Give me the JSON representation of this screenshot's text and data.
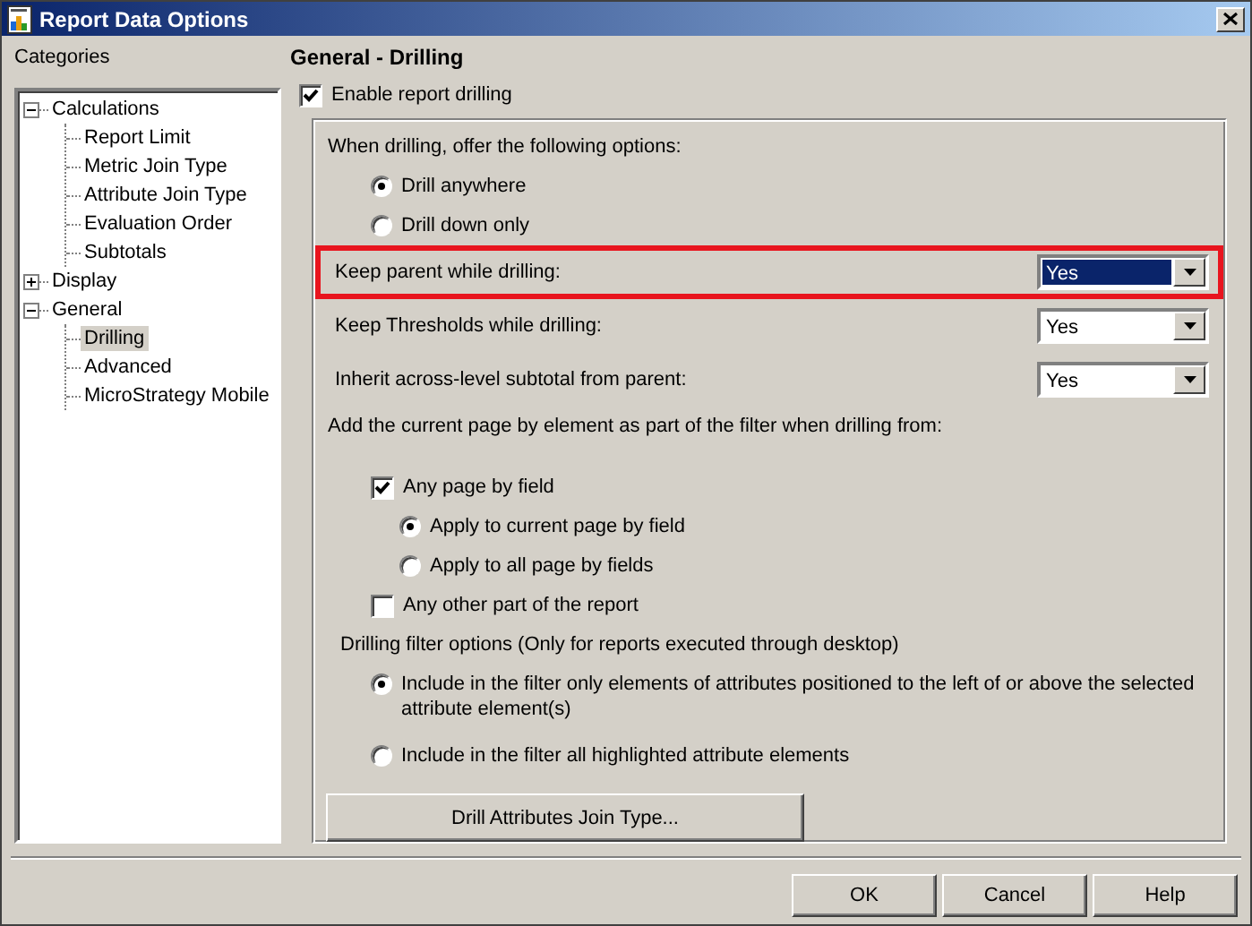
{
  "window": {
    "title": "Report Data Options"
  },
  "categories": {
    "label": "Categories",
    "tree": [
      {
        "label": "Calculations",
        "expanded": true,
        "selected": false,
        "children": [
          {
            "label": "Report Limit",
            "selected": false
          },
          {
            "label": "Metric Join Type",
            "selected": false
          },
          {
            "label": "Attribute Join Type",
            "selected": false
          },
          {
            "label": "Evaluation Order",
            "selected": false
          },
          {
            "label": "Subtotals",
            "selected": false
          }
        ]
      },
      {
        "label": "Display",
        "expanded": false,
        "selected": false
      },
      {
        "label": "General",
        "expanded": true,
        "selected": false,
        "children": [
          {
            "label": "Drilling",
            "selected": true
          },
          {
            "label": "Advanced",
            "selected": false
          },
          {
            "label": "MicroStrategy Mobile",
            "selected": false
          }
        ]
      }
    ]
  },
  "panel": {
    "heading": "General - Drilling",
    "enable": {
      "label": "Enable report drilling",
      "checked": true
    },
    "drill_options": {
      "label": "When drilling, offer the following options:",
      "choices": [
        {
          "label": "Drill anywhere",
          "selected": true
        },
        {
          "label": "Drill down only",
          "selected": false
        }
      ]
    },
    "settings": [
      {
        "label": "Keep parent while drilling:",
        "value": "Yes",
        "highlighted": true
      },
      {
        "label": "Keep Thresholds while drilling:",
        "value": "Yes",
        "highlighted": false
      },
      {
        "label": "Inherit across-level subtotal from parent:",
        "value": "Yes",
        "highlighted": false
      }
    ],
    "page_filter": {
      "label": "Add the current page by element as part of the filter when drilling from:",
      "items": [
        {
          "label": "Any page by field",
          "checked": true,
          "children": [
            {
              "label": "Apply to current page by field",
              "selected": true
            },
            {
              "label": "Apply to all page by fields",
              "selected": false
            }
          ]
        },
        {
          "label": "Any other part of the report",
          "checked": false
        }
      ]
    },
    "filter_options": {
      "label": "Drilling filter options (Only for reports executed through desktop)",
      "choices": [
        {
          "label": "Include in the filter only elements of attributes positioned to the left of or above the selected attribute element(s)",
          "selected": true
        },
        {
          "label": "Include in the filter all highlighted attribute elements",
          "selected": false
        }
      ]
    },
    "join_button": "Drill Attributes Join Type..."
  },
  "buttons": [
    "OK",
    "Cancel",
    "Help"
  ]
}
